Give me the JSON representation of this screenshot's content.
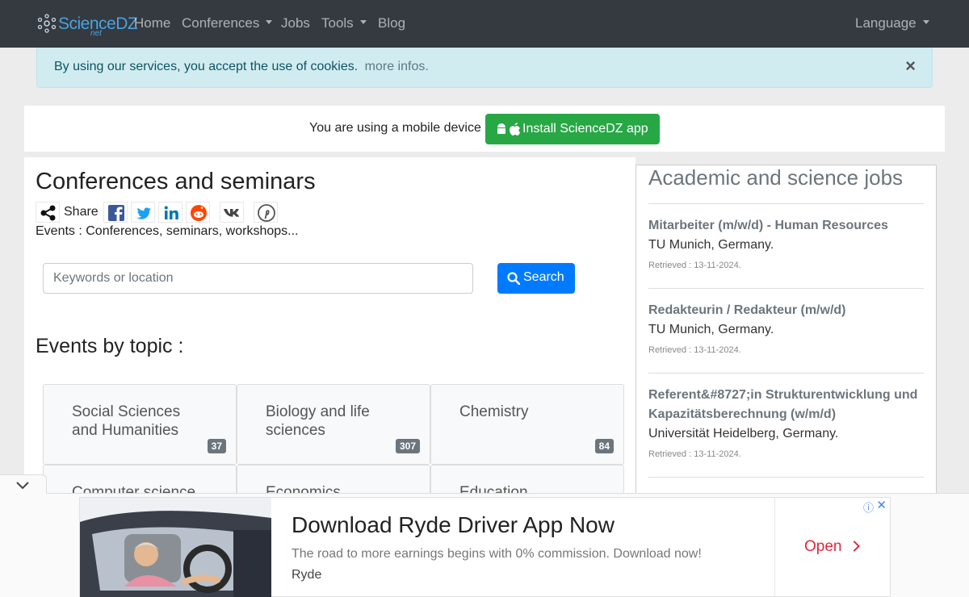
{
  "nav": {
    "logo_text": "ScienceDZ",
    "logo_sub": "net",
    "items": [
      "Home",
      "Conferences",
      "Jobs",
      "Tools",
      "Blog"
    ],
    "language": "Language"
  },
  "cookie": {
    "text": "By using our services, you accept the use of cookies.",
    "link": "more infos.",
    "close": "×"
  },
  "mobile": {
    "text": "You are using a mobile device",
    "button": "Install ScienceDZ app"
  },
  "main": {
    "title": "Conferences and seminars",
    "share_label": "Share",
    "share_networks": [
      "facebook-icon",
      "twitter-icon",
      "linkedin-icon",
      "reddit-icon",
      "vk-icon",
      "pinterest-icon"
    ],
    "description": "Events : Conferences, seminars, workshops...",
    "search_placeholder": "Keywords or location",
    "search_button": "Search",
    "topics_heading": "Events by topic :",
    "topics": [
      {
        "name": "Social Sciences and Humanities",
        "count": "37"
      },
      {
        "name": "Biology and life sciences",
        "count": "307"
      },
      {
        "name": "Chemistry",
        "count": "84"
      },
      {
        "name": "Computer science",
        "count": ""
      },
      {
        "name": "Economics",
        "count": ""
      },
      {
        "name": "Education",
        "count": ""
      }
    ]
  },
  "jobs": {
    "title": "Academic and science jobs",
    "items": [
      {
        "title": "Mitarbeiter (m/w/d) - Human Resources",
        "location": "TU Munich, Germany.",
        "date": "Retrieved : 13-11-2024."
      },
      {
        "title": "Redakteurin / Redakteur (m/w/d)",
        "location": "TU Munich, Germany.",
        "date": "Retrieved : 13-11-2024."
      },
      {
        "title": "Referent&#8727;in Strukturentwicklung und Kapazitätsberechnung (w/m/d)",
        "location": "Universität Heidelberg, Germany.",
        "date": "Retrieved : 13-11-2024."
      }
    ]
  },
  "ad": {
    "headline": "Download Ryde Driver App Now",
    "description": "The road to more earnings begins with 0% commission. Download now!",
    "brand": "Ryde",
    "cta": "Open",
    "info": "ⓘ",
    "close": "✕"
  },
  "colors": {
    "navbar": "#343a40",
    "cookie_bg": "#d1ecf1",
    "install_green": "#28a745",
    "search_blue": "#007bff",
    "ad_red": "#e0293f"
  }
}
